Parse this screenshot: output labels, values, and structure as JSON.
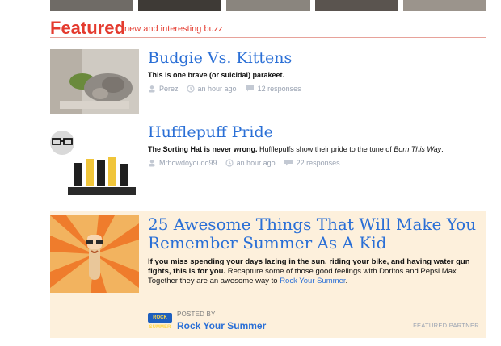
{
  "header": {
    "title": "Featured",
    "subtitle": "new and interesting buzz"
  },
  "posts": [
    {
      "title": "Budgie Vs. Kittens",
      "desc_bold": "This is one brave (or suicidal) parakeet.",
      "desc_rest": "",
      "author": "Perez",
      "time": "an hour ago",
      "responses": "12 responses"
    },
    {
      "title": "Hufflepuff Pride",
      "desc_bold": "The Sorting Hat is never wrong.",
      "desc_rest": " Hufflepuffs show their pride to the tune of ",
      "desc_italic": "Born This Way",
      "desc_end": ".",
      "author": "Mrhowdoyoudo99",
      "time": "an hour ago",
      "responses": "22 responses"
    },
    {
      "title": "25 Awesome Things That Will Make You Remember Summer As A Kid",
      "desc_bold": "If you miss spending your days lazing in the sun, riding your bike, and having water gun fights, this is for you.",
      "desc_rest": " Recapture some of those good feelings with Doritos and Pepsi Max. Together they are an awesome way to ",
      "desc_link": "Rock Your Summer",
      "desc_end": ".",
      "posted_by_label": "POSTED BY",
      "posted_by_name": "Rock Your Summer",
      "featured_partner": "FEATURED PARTNER",
      "logo_text": "ROCK SUMMER"
    }
  ],
  "colors": {
    "accent": "#e43a2e",
    "link": "#2a6fd6",
    "sponsored_bg": "#fdf0dc"
  }
}
